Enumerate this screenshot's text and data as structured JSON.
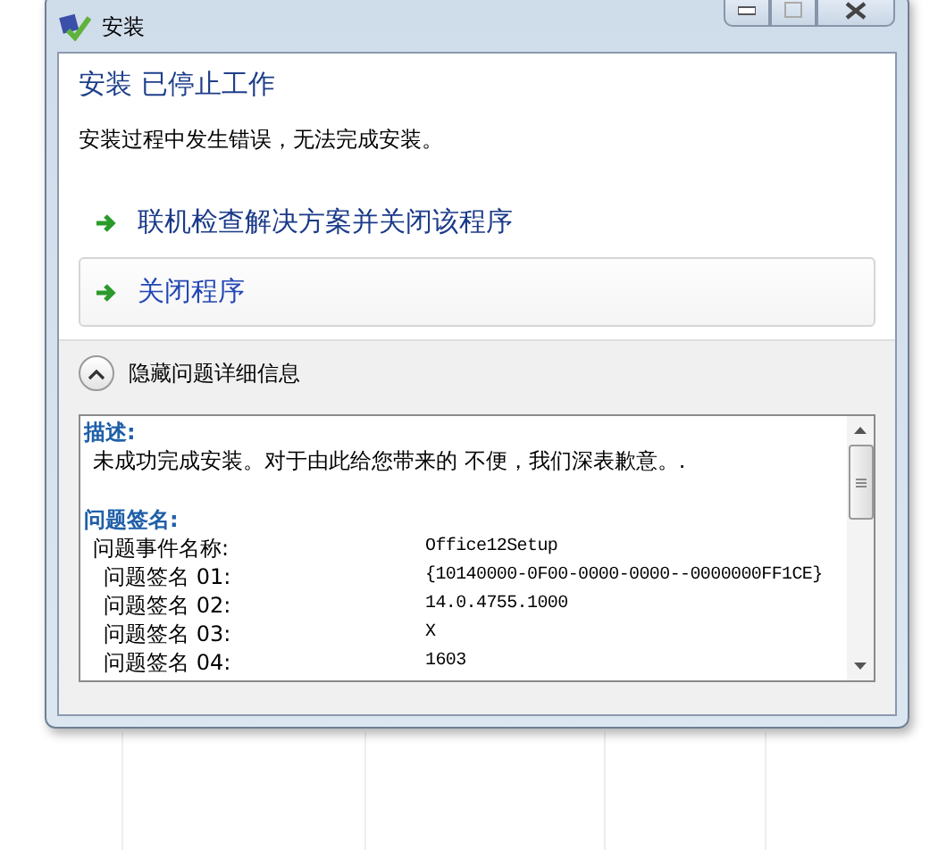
{
  "window": {
    "title": "安装"
  },
  "heading": "安装 已停止工作",
  "message": "安装过程中发生错误，无法完成安装。",
  "actions": [
    {
      "label": "联机检查解决方案并关闭该程序",
      "selected": false
    },
    {
      "label": "关闭程序",
      "selected": true
    }
  ],
  "details_toggle": {
    "label": "隐藏问题详细信息",
    "expanded": true
  },
  "details": {
    "description_heading": "描述:",
    "description": "未成功完成安装。对于由此给您带来的 不便，我们深表歉意。.",
    "signature_heading": "问题签名:",
    "rows": [
      {
        "label": "问题事件名称:",
        "value": "Office12Setup",
        "indent": false
      },
      {
        "label": "问题签名 01:",
        "value": "{10140000-0F00-0000-0000--0000000FF1CE}",
        "indent": true
      },
      {
        "label": "问题签名 02:",
        "value": "14.0.4755.1000",
        "indent": true
      },
      {
        "label": "问题签名 03:",
        "value": "X",
        "indent": true
      },
      {
        "label": "问题签名 04:",
        "value": "1603",
        "indent": true
      }
    ]
  }
}
